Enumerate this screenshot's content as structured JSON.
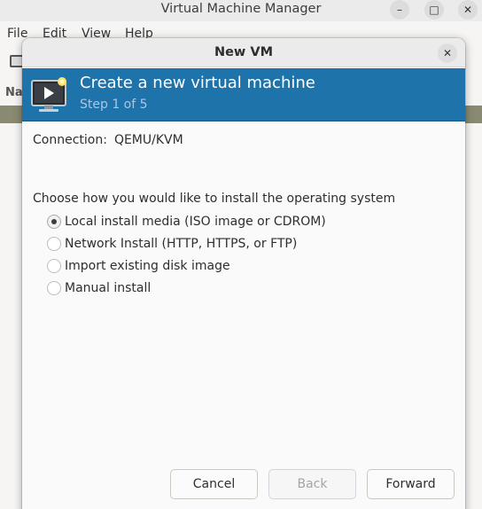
{
  "main_window": {
    "title": "Virtual Machine Manager",
    "menu": [
      "File",
      "Edit",
      "View",
      "Help"
    ],
    "name_column": "Na"
  },
  "dialog": {
    "title": "New VM",
    "header": {
      "title": "Create a new virtual machine",
      "step": "Step 1 of 5"
    },
    "connection": {
      "label": "Connection:",
      "value": "QEMU/KVM"
    },
    "install_prompt": "Choose how you would like to install the operating system",
    "install_options": [
      {
        "label": "Local install media (ISO image or CDROM)",
        "selected": true
      },
      {
        "label": "Network Install (HTTP, HTTPS, or FTP)",
        "selected": false
      },
      {
        "label": "Import existing disk image",
        "selected": false
      },
      {
        "label": "Manual install",
        "selected": false
      }
    ],
    "buttons": {
      "cancel": "Cancel",
      "back": "Back",
      "forward": "Forward"
    }
  },
  "colors": {
    "header_bg": "#1e73ab",
    "header_step": "#a9c7e8"
  },
  "icons": {
    "minimize": "–",
    "maximize": "□",
    "close": "✕"
  }
}
